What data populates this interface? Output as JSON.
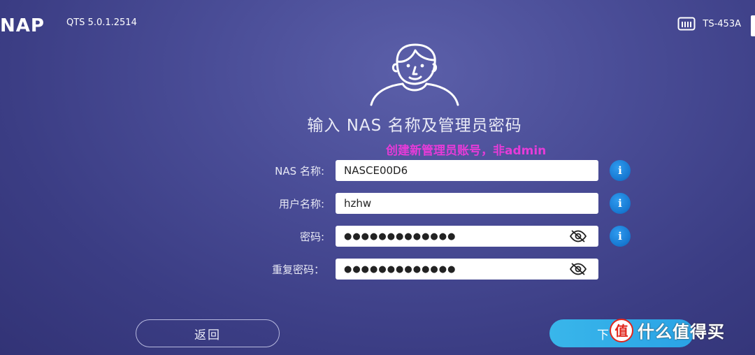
{
  "header": {
    "logo": "NAP",
    "version": "QTS 5.0.1.2514",
    "model": "TS-453A",
    "model_icon": "nas-device-icon"
  },
  "title": "输入 NAS 名称及管理员密码",
  "annotation": "创建新管理员账号，非admin",
  "form": {
    "nas_name": {
      "label": "NAS 名称:",
      "value": "NASCE00D6",
      "info_icon": "info-icon"
    },
    "username": {
      "label": "用户名称:",
      "value": "hzhw",
      "info_icon": "info-icon"
    },
    "password": {
      "label": "密码:",
      "value": "●●●●●●●●●●●●●",
      "toggle_icon": "eye-slash-icon",
      "info_icon": "info-icon"
    },
    "confirm_password": {
      "label": "重复密码：",
      "value": "●●●●●●●●●●●●●",
      "toggle_icon": "eye-slash-icon"
    }
  },
  "buttons": {
    "back": "返回",
    "next": "下"
  },
  "info_glyph": "i",
  "watermark": {
    "badge": "值",
    "text": "什么值得买"
  },
  "colors": {
    "background": "#4a4d97",
    "annotation": "#e53bd8",
    "info": "#1677d0",
    "next_button": "#2aa3e6"
  }
}
